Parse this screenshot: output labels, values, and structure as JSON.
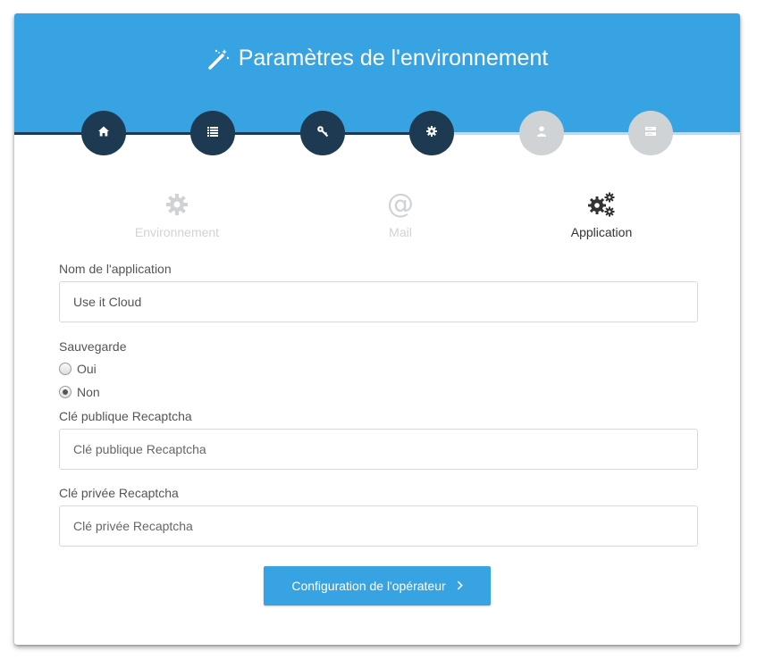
{
  "header": {
    "title": "Paramètres de l'environnement",
    "title_icon": "magic-wand-icon"
  },
  "steps": [
    {
      "icon": "home-icon",
      "state": "done"
    },
    {
      "icon": "list-icon",
      "state": "done"
    },
    {
      "icon": "key-icon",
      "state": "done"
    },
    {
      "icon": "gear-icon",
      "state": "done"
    },
    {
      "icon": "user-icon",
      "state": "pending"
    },
    {
      "icon": "server-icon",
      "state": "pending"
    }
  ],
  "tabs": [
    {
      "label": "Environnement",
      "icon": "gear-icon",
      "active": false
    },
    {
      "label": "Mail",
      "icon": "at-icon",
      "active": false
    },
    {
      "label": "Application",
      "icon": "gears-icon",
      "active": true
    }
  ],
  "form": {
    "app_name": {
      "label": "Nom de l'application",
      "value": "Use it Cloud",
      "placeholder": ""
    },
    "backup": {
      "label": "Sauvegarde",
      "options": [
        {
          "label": "Oui",
          "checked": false
        },
        {
          "label": "Non",
          "checked": true
        }
      ]
    },
    "recaptcha_public": {
      "label": "Clé publique Recaptcha",
      "value": "",
      "placeholder": "Clé publique Recaptcha"
    },
    "recaptcha_private": {
      "label": "Clé privée Recaptcha",
      "value": "",
      "placeholder": "Clé privée Recaptcha"
    }
  },
  "actions": {
    "next_label": "Configuration de l'opérateur",
    "next_icon": "chevron-right-icon"
  },
  "colors": {
    "primary": "#38a3e3",
    "step_active": "#1e3a52",
    "step_inactive": "#cfd3d6"
  }
}
